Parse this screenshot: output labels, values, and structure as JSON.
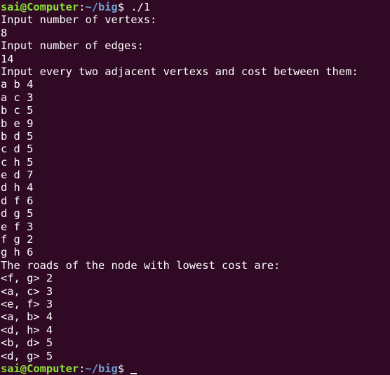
{
  "prompt": {
    "user_host": "sai@Computer",
    "separator": ":",
    "path": "~/big",
    "symbol": "$ "
  },
  "command": "./1",
  "output_lines": [
    "Input number of vertexs:",
    "8",
    "Input number of edges:",
    "14",
    "Input every two adjacent vertexs and cost between them:",
    "a b 4",
    "a c 3",
    "b c 5",
    "b e 9",
    "b d 5",
    "c d 5",
    "c h 5",
    "e d 7",
    "d h 4",
    "d f 6",
    "d g 5",
    "e f 3",
    "f g 2",
    "g h 6",
    "The roads of the node with lowest cost are:",
    "<f, g> 2",
    "<a, c> 3",
    "<e, f> 3",
    "<a, b> 4",
    "<d, h> 4",
    "<b, d> 5",
    "<d, g> 5"
  ],
  "colors": {
    "background": "#300a24",
    "text": "#ffffff",
    "user_host": "#8ae234",
    "path": "#729fcf"
  }
}
